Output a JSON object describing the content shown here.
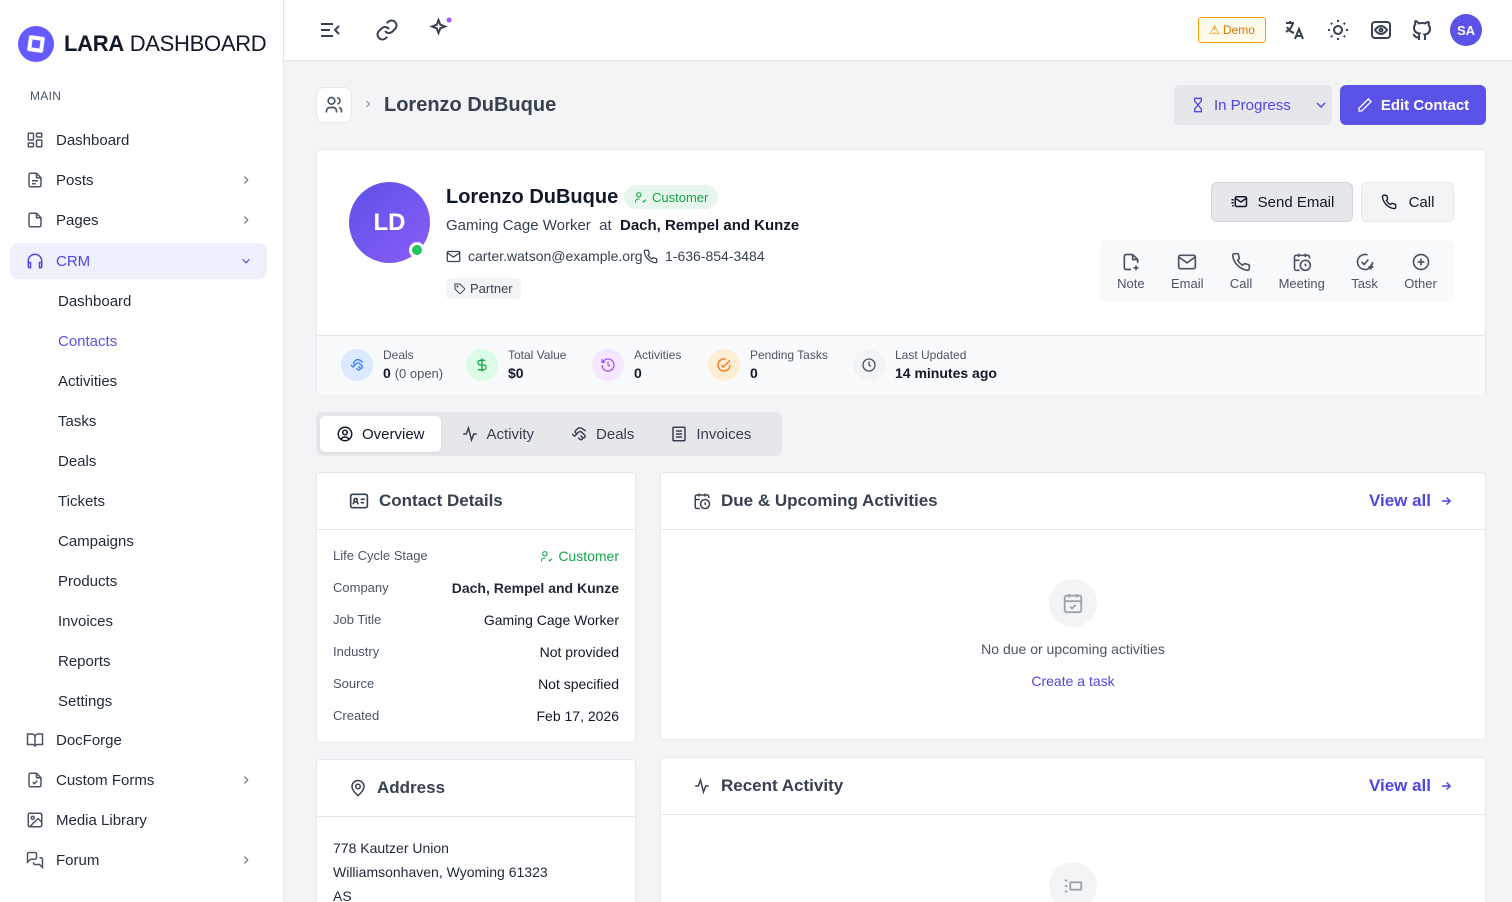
{
  "sidebar": {
    "logo_bold": "LARA",
    "logo_light": "DASHBOARD",
    "section": "MAIN",
    "items": [
      {
        "label": "Dashboard"
      },
      {
        "label": "Posts"
      },
      {
        "label": "Pages"
      },
      {
        "label": "CRM"
      },
      {
        "label": "DocForge"
      },
      {
        "label": "Custom Forms"
      },
      {
        "label": "Media Library"
      },
      {
        "label": "Forum"
      }
    ],
    "crm_sub": [
      "Dashboard",
      "Contacts",
      "Activities",
      "Tasks",
      "Deals",
      "Tickets",
      "Campaigns",
      "Products",
      "Invoices",
      "Reports",
      "Settings"
    ]
  },
  "topbar": {
    "demo_label": "Demo",
    "avatar_initials": "SA"
  },
  "header": {
    "title": "Lorenzo DuBuque",
    "status_label": "In Progress",
    "edit_label": "Edit Contact"
  },
  "contact": {
    "initials": "LD",
    "name": "Lorenzo DuBuque",
    "stage_badge": "Customer",
    "job_title": "Gaming Cage Worker",
    "at": "at",
    "company": "Dach, Rempel and Kunze",
    "email": "carter.watson@example.org",
    "phone": "1-636-854-3484",
    "tag": "Partner"
  },
  "actions": {
    "send_email": "Send Email",
    "call": "Call"
  },
  "quick_actions": [
    "Note",
    "Email",
    "Call",
    "Meeting",
    "Task",
    "Other"
  ],
  "stats": {
    "deals": {
      "label": "Deals",
      "value": "0",
      "sub": "(0 open)"
    },
    "total_value": {
      "label": "Total Value",
      "value": "$0"
    },
    "activities": {
      "label": "Activities",
      "value": "0"
    },
    "pending_tasks": {
      "label": "Pending Tasks",
      "value": "0"
    },
    "last_updated": {
      "label": "Last Updated",
      "value": "14 minutes ago"
    }
  },
  "tabs": [
    "Overview",
    "Activity",
    "Deals",
    "Invoices"
  ],
  "contact_details": {
    "title": "Contact Details",
    "rows": [
      {
        "k": "Life Cycle Stage",
        "v": "Customer"
      },
      {
        "k": "Company",
        "v": "Dach, Rempel and Kunze"
      },
      {
        "k": "Job Title",
        "v": "Gaming Cage Worker"
      },
      {
        "k": "Industry",
        "v": "Not provided"
      },
      {
        "k": "Source",
        "v": "Not specified"
      },
      {
        "k": "Created",
        "v": "Feb 17, 2026"
      }
    ]
  },
  "upcoming": {
    "title": "Due & Upcoming Activities",
    "view_all": "View all",
    "empty": "No due or upcoming activities",
    "create_link": "Create a task"
  },
  "address": {
    "title": "Address",
    "line1": "778 Kautzer Union",
    "line2": "Williamsonhaven, Wyoming 61323",
    "line3": "AS"
  },
  "recent": {
    "title": "Recent Activity",
    "view_all": "View all"
  },
  "colors": {
    "accent": "#5b52e8",
    "success": "#16a34a",
    "warning": "#d97706"
  }
}
